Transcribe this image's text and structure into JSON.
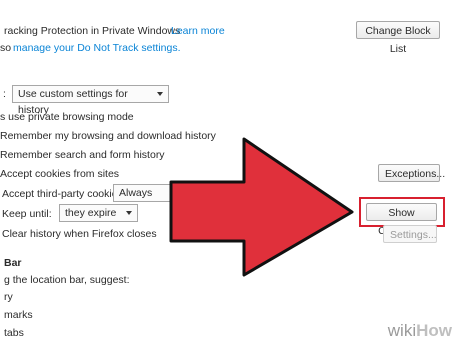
{
  "tracking": {
    "text": "racking Protection in Private Windows",
    "learn_more": "Learn more",
    "change_block_list": "Change Block List"
  },
  "dnt": {
    "prefix": "so",
    "link": "manage your Do Not Track settings."
  },
  "history": {
    "select_prefix": ":",
    "select_value": "Use custom settings for history",
    "always_private": "s use private browsing mode",
    "remember_browsing": "Remember my browsing and download history",
    "remember_search": "Remember search and form history",
    "accept_cookies": "Accept cookies from sites",
    "exceptions_button": "Exceptions...",
    "third_party_label": "Accept third-party cookies:",
    "third_party_value": "Always",
    "keep_until_label": "Keep until:",
    "keep_until_value": "they expire",
    "show_cookies_button": "Show Cookies...",
    "clear_history": "Clear history when Firefox closes",
    "settings_button": "Settings..."
  },
  "location_bar": {
    "heading": "Bar",
    "suggest": "g the location bar, suggest:",
    "items": [
      "ry",
      "marks",
      "tabs"
    ]
  },
  "colors": {
    "arrow": "#e0303b",
    "arrow_outline": "#111111",
    "highlight": "#d8202f",
    "link": "#0a84d6"
  },
  "watermark": {
    "w": "wiki",
    "how": "How"
  }
}
